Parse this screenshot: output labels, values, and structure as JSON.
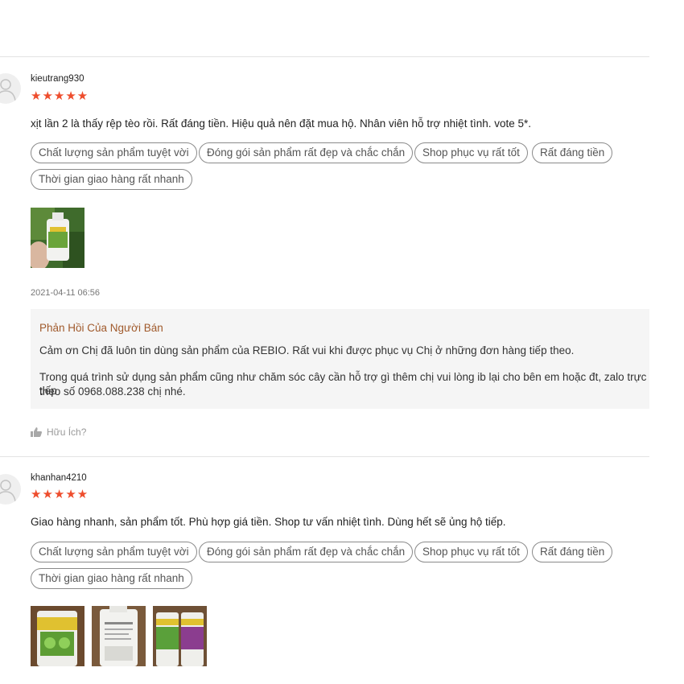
{
  "reviews": [
    {
      "username": "kieutrang930",
      "stars": "★★★★★",
      "rating": 5,
      "comment": "xịt lần 2 là thấy rệp tèo rồi. Rất đáng tiền. Hiệu quả nên đặt mua hộ. Nhân viên hỗ trợ nhiệt tình. vote 5*.",
      "tags": [
        "Chất lượng sản phẩm tuyệt vời",
        "Đóng gói sản phẩm rất đẹp và chắc chắn",
        "Shop phục vụ rất tốt",
        "Rất đáng tiền",
        "Thời gian giao hàng rất nhanh"
      ],
      "date": "2021-04-11 06:56",
      "seller_reply": {
        "title": "Phản Hồi Của Người Bán",
        "line1": "Cảm ơn Chị đã luôn tin dùng sản phẩm của REBIO. Rất vui khi được phục vụ Chị ở những đơn hàng tiếp theo.",
        "line2": "Trong quá trình sử dụng sản phẩm cũng như chăm sóc cây cần hỗ trợ gì thêm chị vui lòng ib lại cho bên em hoặc đt, zalo trực tiếp",
        "line3": "theo số 0968.088.238 chị nhé."
      },
      "helpful_label": "Hữu Ích?"
    },
    {
      "username": "khanhan4210",
      "stars": "★★★★★",
      "rating": 5,
      "comment": "Giao hàng nhanh, sản phẩm tốt. Phù hợp giá tiền. Shop tư vấn nhiệt tình. Dùng hết sẽ ủng hộ tiếp.",
      "tags": [
        "Chất lượng sản phẩm tuyệt vời",
        "Đóng gói sản phẩm rất đẹp và chắc chắn",
        "Shop phục vụ rất tốt",
        "Rất đáng tiền",
        "Thời gian giao hàng rất nhanh"
      ]
    }
  ],
  "colors": {
    "star": "#ee4d2d",
    "reply_title": "#a05a2c",
    "reply_bg": "#f5f5f5"
  },
  "icons": {
    "avatar": "user-avatar-icon",
    "helpful": "thumbs-up-icon"
  }
}
